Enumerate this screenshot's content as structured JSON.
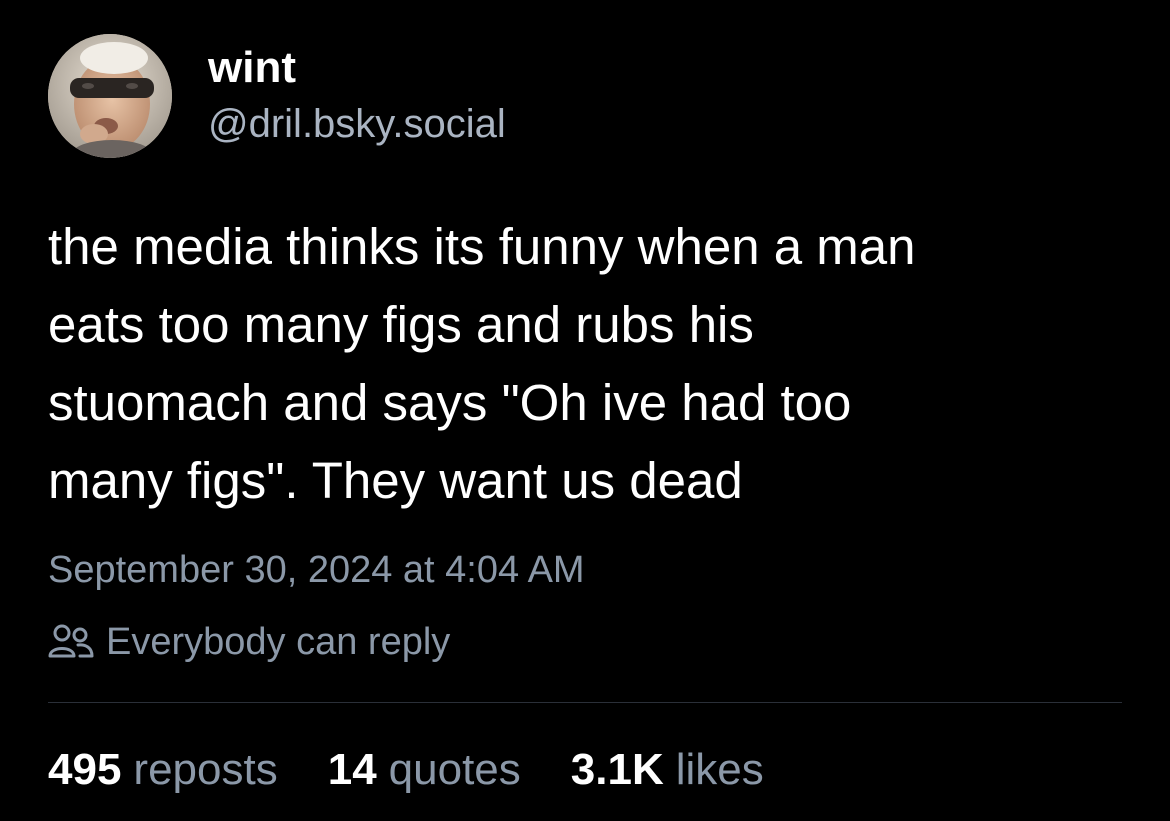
{
  "author": {
    "display_name": "wint",
    "handle": "@dril.bsky.social",
    "avatar_icon": "avatar-photo"
  },
  "post": {
    "text": "the media thinks its funny when a man\neats too many figs and rubs his\nstuomach and says \"Oh ive had too\nmany figs\". They want us dead",
    "timestamp": "September 30, 2024 at 4:04 AM",
    "reply_setting": "Everybody can reply",
    "reply_icon": "people-icon"
  },
  "stats": {
    "reposts_count": "495",
    "reposts_label": "reposts",
    "quotes_count": "14",
    "quotes_label": "quotes",
    "likes_count": "3.1K",
    "likes_label": "likes"
  },
  "colors": {
    "background": "#000000",
    "primary_text": "#ffffff",
    "secondary_text": "#8b98a8",
    "divider": "#2a2f38"
  }
}
